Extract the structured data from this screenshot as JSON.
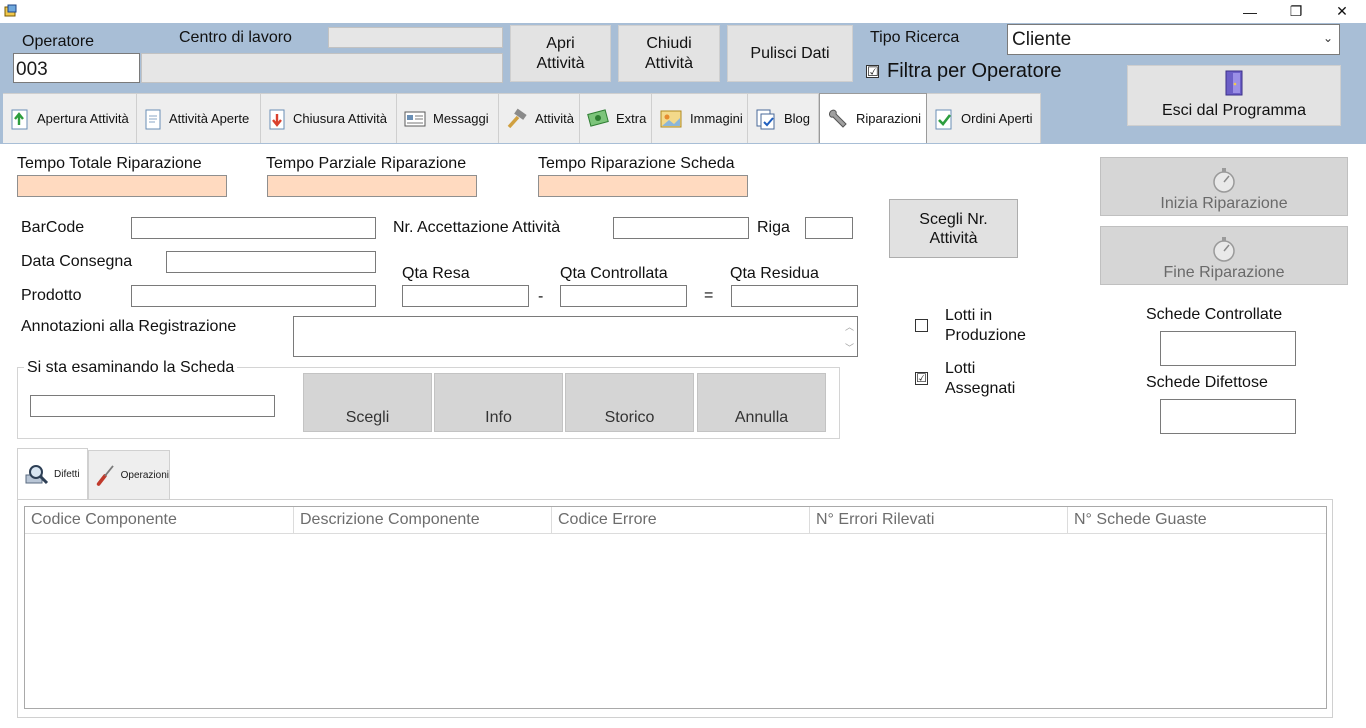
{
  "window": {
    "minimize_glyph": "—",
    "maximize_glyph": "❐",
    "close_glyph": "✕"
  },
  "header": {
    "operatore_label": "Operatore",
    "operatore_value": "003",
    "centro_label": "Centro di lavoro",
    "centro_value": "",
    "operatore_name_value": "",
    "btn_apri": "Apri\nAttività",
    "btn_chiudi": "Chiudi\nAttività",
    "btn_pulisci": "Pulisci Dati",
    "tipo_ricerca_label": "Tipo Ricerca",
    "tipo_ricerca_value": "Cliente",
    "filtra_label": "Filtra per Operatore",
    "filtra_checked": "☑",
    "esci_label": "Esci dal Programma"
  },
  "tabs": [
    {
      "label": "Apertura Attività",
      "icon": "upload-doc-icon"
    },
    {
      "label": "Attività Aperte",
      "icon": "document-icon"
    },
    {
      "label": "Chiusura Attività",
      "icon": "download-doc-icon"
    },
    {
      "label": "Messaggi",
      "icon": "message-card-icon"
    },
    {
      "label": "Attività",
      "icon": "hammer-icon"
    },
    {
      "label": "Extra",
      "icon": "money-icon"
    },
    {
      "label": "Immagini",
      "icon": "image-icon"
    },
    {
      "label": "Blog",
      "icon": "blog-check-icon"
    },
    {
      "label": "Riparazioni",
      "icon": "wrench-icon"
    },
    {
      "label": "Ordini Aperti",
      "icon": "checkmark-doc-icon"
    }
  ],
  "active_tab": "Riparazioni",
  "times": {
    "totale_label": "Tempo Totale Riparazione",
    "parziale_label": "Tempo Parziale Riparazione",
    "scheda_label": "Tempo Riparazione Scheda"
  },
  "form": {
    "barcode_label": "BarCode",
    "nr_accettazione_label": "Nr. Accettazione Attività",
    "riga_label": "Riga",
    "data_consegna_label": "Data Consegna",
    "prodotto_label": "Prodotto",
    "qta_resa_label": "Qta Resa",
    "qta_controllata_label": "Qta Controllata",
    "qta_residua_label": "Qta Residua",
    "minus_sign": "-",
    "equals_sign": "=",
    "annotazioni_label": "Annotazioni alla Registrazione",
    "scroll_up": "︿",
    "scroll_down": "﹀"
  },
  "scheda_group": {
    "title": "Si sta esaminando la Scheda",
    "btn_scegli": "Scegli",
    "btn_info": "Info",
    "btn_storico": "Storico",
    "btn_annulla": "Annulla"
  },
  "scegli_nr": "Scegli Nr.\nAttività",
  "lotti": {
    "produzione_label": "Lotti in\nProduzione",
    "produzione_check": "",
    "assegnati_label": "Lotti\nAssegnati",
    "assegnati_check": "☑"
  },
  "repair_buttons": {
    "inizia": "Inizia Riparazione",
    "fine": "Fine Riparazione"
  },
  "schede": {
    "controllate_label": "Schede Controllate",
    "difettose_label": "Schede Difettose"
  },
  "subtabs": [
    {
      "label": "Difetti",
      "icon": "magnifier-icon"
    },
    {
      "label": "Operazioni",
      "icon": "screwdriver-icon"
    }
  ],
  "grid": {
    "columns": [
      "Codice Componente",
      "Descrizione Componente",
      "Codice Errore",
      "N° Errori Rilevati",
      "N° Schede Guaste"
    ],
    "rows": []
  },
  "colors": {
    "header_bg": "#a8bed6",
    "time_box": "#ffdac0",
    "button_grey": "#d5d5d5"
  }
}
